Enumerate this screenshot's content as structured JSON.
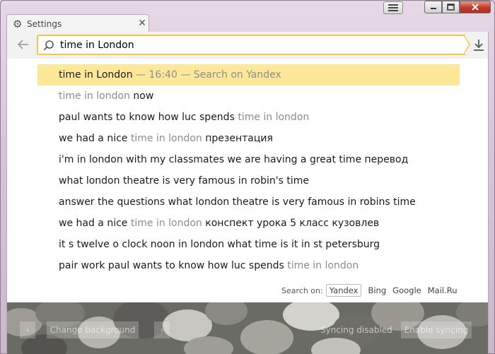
{
  "window": {
    "menu_icon": "hamburger-icon",
    "minimize_icon": "minimize-icon",
    "maximize_icon": "maximize-icon",
    "close_icon": "close-icon"
  },
  "tab": {
    "title": "Settings",
    "icon": "gear-icon",
    "close_glyph": "✕"
  },
  "toolbar": {
    "query": "time in London"
  },
  "suggestions": [
    {
      "parts": [
        {
          "t": "time in London",
          "g": false
        },
        {
          "t": " — 16:40 — Search on Yandex",
          "g": true
        }
      ],
      "active": true
    },
    {
      "parts": [
        {
          "t": "time in london",
          "g": true
        },
        {
          "t": " now",
          "g": false
        }
      ],
      "active": false
    },
    {
      "parts": [
        {
          "t": "paul wants to know how luc spends ",
          "g": false
        },
        {
          "t": "time in london",
          "g": true
        }
      ],
      "active": false
    },
    {
      "parts": [
        {
          "t": "we had a nice ",
          "g": false
        },
        {
          "t": "time in london",
          "g": true
        },
        {
          "t": " презентация",
          "g": false
        }
      ],
      "active": false
    },
    {
      "parts": [
        {
          "t": "i'm in london with my classmates we are having a great time перевод",
          "g": false
        }
      ],
      "active": false
    },
    {
      "parts": [
        {
          "t": "what london theatre is very famous in robin's time",
          "g": false
        }
      ],
      "active": false
    },
    {
      "parts": [
        {
          "t": "answer the questions what london theatre is very famous in robins time",
          "g": false
        }
      ],
      "active": false
    },
    {
      "parts": [
        {
          "t": "we had a nice ",
          "g": false
        },
        {
          "t": "time in london",
          "g": true
        },
        {
          "t": " конспект урока 5 класс кузовлев",
          "g": false
        }
      ],
      "active": false
    },
    {
      "parts": [
        {
          "t": "it s twelve o clock noon in london what time is it in st petersburg",
          "g": false
        }
      ],
      "active": false
    },
    {
      "parts": [
        {
          "t": "pair work paul wants to know how luc spends ",
          "g": false
        },
        {
          "t": "time in london",
          "g": true
        }
      ],
      "active": false
    }
  ],
  "search_on": {
    "label": "Search on:",
    "engines": [
      "Yandex",
      "Bing",
      "Google",
      "Mail.Ru"
    ],
    "selected": "Yandex"
  },
  "bottom_bar": {
    "prev_glyph": "‹",
    "change_background": "Change background",
    "next_glyph": "›",
    "syncing_status": "Syncing disabled",
    "enable_syncing": "Enable syncing"
  },
  "colors": {
    "omnibox_border": "#f2c94c",
    "active_suggestion": "#fde89a",
    "gray_text": "#8c8c8c"
  }
}
